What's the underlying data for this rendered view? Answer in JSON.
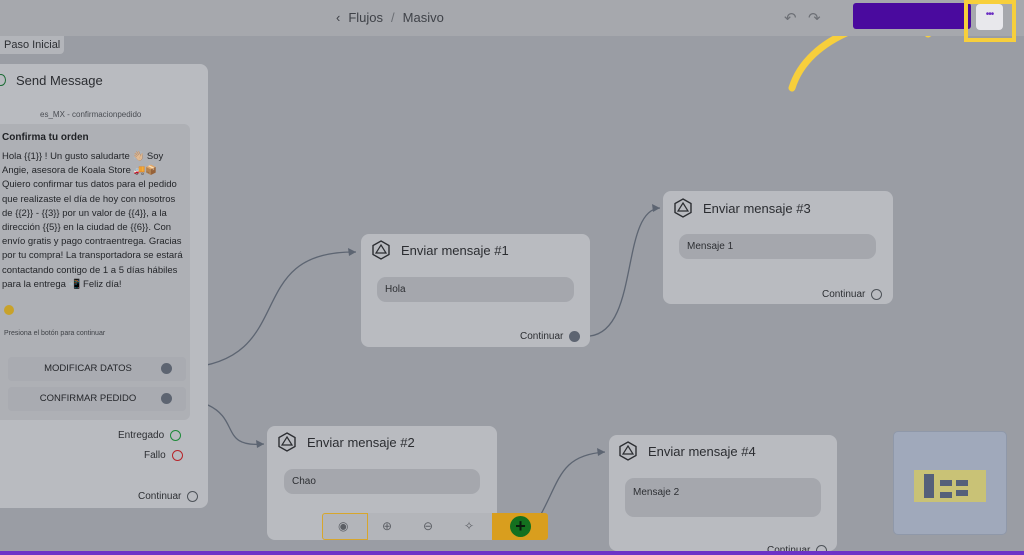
{
  "breadcrumb": {
    "parent": "Flujos",
    "current": "Masivo"
  },
  "step_tab": "Paso Inicial",
  "send_card": {
    "title": "Send Message",
    "template": "es_MX - confirmacionpedido",
    "message_title": "Confirma tu orden",
    "message_body": "Hola {{1}} ! Un gusto saludarte 👋🏼 Soy Angie, asesora de Koala Store 🚚📦 Quiero confirmar tus datos para el pedido que realizaste el día de hoy con nosotros de {{2}} - {{3}} por un valor de {{4}}, a la dirección {{5}} en la ciudad de {{6}}. Con envío gratis y pago contraentrega. Gracias por tu compra! La transportadora se estará contactando contigo de 1 a 5 días hábiles para la entrega 📲 Feliz día!",
    "press_note": "Presiona el botón para continuar",
    "buttons": [
      "MODIFICAR DATOS",
      "CONFIRMAR PEDIDO"
    ],
    "delivered": "Entregado",
    "failed": "Fallo",
    "continue": "Continuar"
  },
  "nodes": [
    {
      "title": "Enviar mensaje #1",
      "message": "Hola",
      "continue": "Continuar"
    },
    {
      "title": "Enviar mensaje #2",
      "message": "Chao"
    },
    {
      "title": "Enviar mensaje #3",
      "message": "Mensaje 1",
      "continue": "Continuar"
    },
    {
      "title": "Enviar mensaje #4",
      "message": "Mensaje 2",
      "continue": "Continuar"
    }
  ],
  "colors": {
    "accent": "#4a0a9e",
    "highlight": "#f7cf3c",
    "add": "#14701f"
  }
}
